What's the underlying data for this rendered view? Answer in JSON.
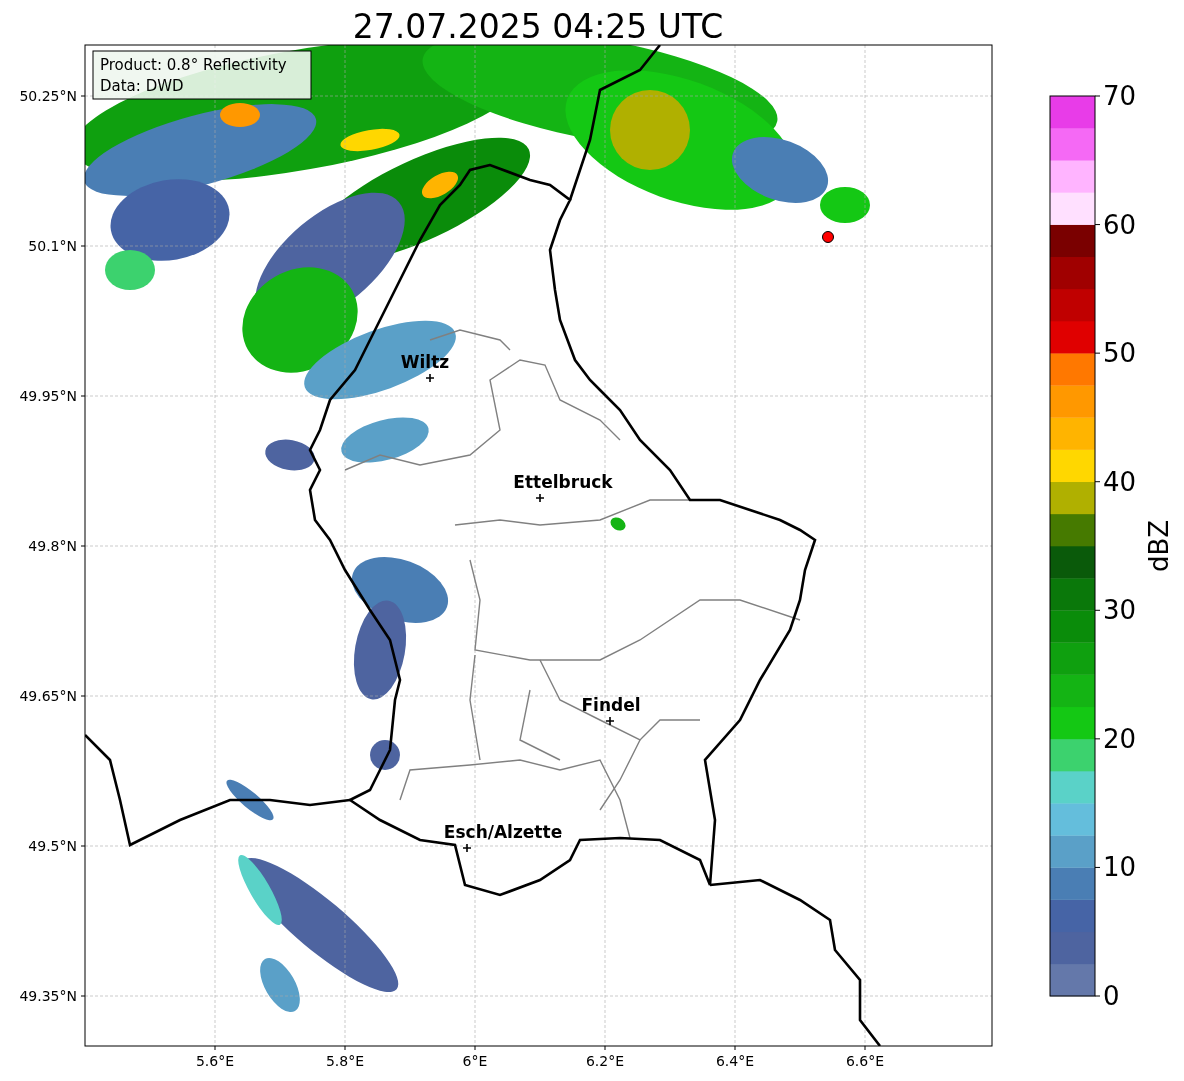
{
  "title": "27.07.2025 04:25 UTC",
  "map": {
    "info": [
      "Product: 0.8° Reflectivity",
      "Data: DWD"
    ],
    "xticks": [
      "5.6°E",
      "5.8°E",
      "6°E",
      "6.2°E",
      "6.4°E",
      "6.6°E"
    ],
    "yticks": [
      "50.25°N",
      "50.1°N",
      "49.95°N",
      "49.8°N",
      "49.65°N",
      "49.5°N",
      "49.35°N"
    ],
    "cities": [
      {
        "name": "Wiltz"
      },
      {
        "name": "Ettelbruck"
      },
      {
        "name": "Findel"
      },
      {
        "name": "Esch/Alzette"
      }
    ]
  },
  "colorbar": {
    "label": "dBZ",
    "ticks": [
      "70",
      "60",
      "50",
      "40",
      "30",
      "20",
      "10",
      "0"
    ],
    "bins": [
      {
        "color": "#6478aa"
      },
      {
        "color": "#4e64a0"
      },
      {
        "color": "#4664a6"
      },
      {
        "color": "#4a7eb4"
      },
      {
        "color": "#5aa0c8"
      },
      {
        "color": "#64bedc"
      },
      {
        "color": "#5ad2c8"
      },
      {
        "color": "#3cd26e"
      },
      {
        "color": "#14c814"
      },
      {
        "color": "#14b414"
      },
      {
        "color": "#0fa00f"
      },
      {
        "color": "#0a8c0a"
      },
      {
        "color": "#0a780a"
      },
      {
        "color": "#0a5a0a"
      },
      {
        "color": "#467a00"
      },
      {
        "color": "#b0b000"
      },
      {
        "color": "#ffd700"
      },
      {
        "color": "#ffb400"
      },
      {
        "color": "#ff9800"
      },
      {
        "color": "#ff7800"
      },
      {
        "color": "#e00000"
      },
      {
        "color": "#c00000"
      },
      {
        "color": "#a00000"
      },
      {
        "color": "#7a0000"
      },
      {
        "color": "#ffe0ff"
      },
      {
        "color": "#ffb4ff"
      },
      {
        "color": "#f569f5"
      },
      {
        "color": "#e83ce8"
      }
    ]
  }
}
